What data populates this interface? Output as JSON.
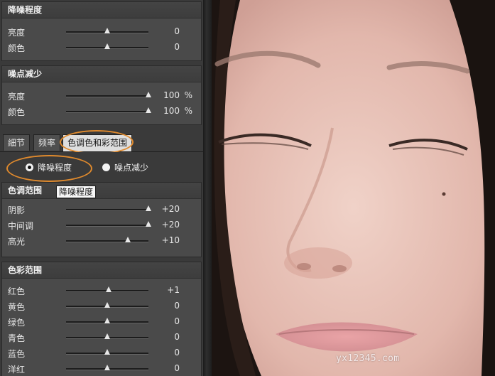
{
  "noise_reduction": {
    "title": "降噪程度",
    "rows": [
      {
        "label": "亮度",
        "value": "0",
        "level": 50
      },
      {
        "label": "颜色",
        "value": "0",
        "level": 50
      }
    ]
  },
  "noise_reduce": {
    "title": "噪点减少",
    "unit": "%",
    "rows": [
      {
        "label": "亮度",
        "value": "100",
        "level": 100
      },
      {
        "label": "颜色",
        "value": "100",
        "level": 100
      }
    ]
  },
  "tabs": [
    "細节",
    "频率",
    "色调色和彩范围"
  ],
  "mode": {
    "options": [
      "降噪程度",
      "噪点减少"
    ],
    "selected": 0
  },
  "tone_range": {
    "title": "色调范围",
    "tooltip": "降噪程度",
    "rows": [
      {
        "label": "阴影",
        "value": "+20",
        "level": 100
      },
      {
        "label": "中间调",
        "value": "+20",
        "level": 100
      },
      {
        "label": "高光",
        "value": "+10",
        "level": 75
      }
    ]
  },
  "color_range": {
    "title": "色彩范围",
    "rows": [
      {
        "label": "红色",
        "value": "+1",
        "level": 52
      },
      {
        "label": "黄色",
        "value": "0",
        "level": 50
      },
      {
        "label": "绿色",
        "value": "0",
        "level": 50
      },
      {
        "label": "青色",
        "value": "0",
        "level": 50
      },
      {
        "label": "蓝色",
        "value": "0",
        "level": 50
      },
      {
        "label": "洋红",
        "value": "0",
        "level": 50
      }
    ]
  },
  "watermark": "yx12345.com"
}
